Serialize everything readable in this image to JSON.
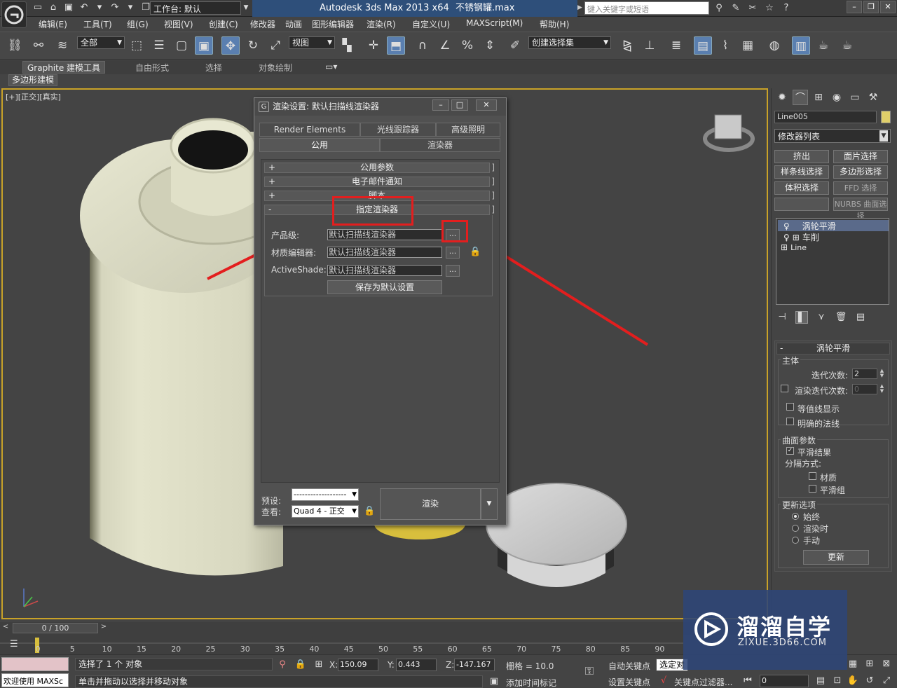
{
  "titlebar": {
    "workspace": "工作台: 默认",
    "app_title": "Autodesk 3ds Max  2013 x64",
    "file_name": "不锈钢罐.max",
    "search_placeholder": "键入关键字或短语"
  },
  "menu": [
    "编辑(E)",
    "工具(T)",
    "组(G)",
    "视图(V)",
    "创建(C)",
    "修改器",
    "动画",
    "图形编辑器",
    "渲染(R)",
    "自定义(U)",
    "MAXScript(M)",
    "帮助(H)"
  ],
  "toolbar": {
    "selection_filter": "全部",
    "ref_coord": "视图",
    "named_selection": "创建选择集"
  },
  "ribbon": {
    "tabs": [
      "Graphite 建模工具",
      "自由形式",
      "选择",
      "对象绘制"
    ],
    "sub_label": "多边形建模"
  },
  "viewport": {
    "label": "[+][正交][真实]"
  },
  "command_panel": {
    "object_name": "Line005",
    "modifier_list": "修改器列表",
    "buttons": [
      "挤出",
      "面片选择",
      "样条线选择",
      "多边形选择",
      "体积选择",
      "FFD 选择",
      "",
      "NURBS 曲面选择"
    ],
    "stack": [
      "涡轮平滑",
      "车削",
      "Line"
    ],
    "rollout_title": "涡轮平滑",
    "main_group": "主体",
    "iterations_label": "迭代次数:",
    "iterations_value": "2",
    "render_iters_label": "渲染迭代次数:",
    "render_iters_value": "0",
    "isoline": "等值线显示",
    "explicit_normals": "明确的法线",
    "surface_group": "曲面参数",
    "smooth_result": "平滑结果",
    "separate_by": "分隔方式:",
    "materials": "材质",
    "smoothing_groups": "平滑组",
    "update_group": "更新选项",
    "always": "始终",
    "when_rendering": "渲染时",
    "manually": "手动",
    "update_btn": "更新"
  },
  "dialog": {
    "title": "渲染设置: 默认扫描线渲染器",
    "tabs_row1": [
      "Render Elements",
      "光线跟踪器",
      "高级照明"
    ],
    "tabs_row2": [
      "公用",
      "渲染器"
    ],
    "rollouts": [
      {
        "sign": "+",
        "label": "公用参数"
      },
      {
        "sign": "+",
        "label": "电子邮件通知"
      },
      {
        "sign": "+",
        "label": "脚本"
      },
      {
        "sign": "-",
        "label": "指定渲染器"
      }
    ],
    "production_label": "产品级:",
    "production_value": "默认扫描线渲染器",
    "material_editor_label": "材质编辑器:",
    "material_editor_value": "默认扫描线渲染器",
    "activeshade_label": "ActiveShade:",
    "activeshade_value": "默认扫描线渲染器",
    "dots": "...",
    "save_default": "保存为默认设置",
    "preset_label": "预设:",
    "preset_value": "-------------------",
    "view_label": "查看:",
    "view_value": "Quad 4 - 正交",
    "render_btn": "渲染"
  },
  "timeline": {
    "frame_display": "0 / 100",
    "ticks": [
      "0",
      "5",
      "10",
      "15",
      "20",
      "25",
      "30",
      "35",
      "40",
      "45",
      "50",
      "55",
      "60",
      "65",
      "70",
      "75",
      "80",
      "85",
      "90"
    ]
  },
  "status": {
    "selection": "选择了 1 个 对象",
    "prompt": "单击并拖动以选择并移动对象",
    "welcome": "欢迎使用 MAXSc",
    "x_label": "X:",
    "x_value": "150.09",
    "y_label": "Y:",
    "y_value": "0.443",
    "z_label": "Z:",
    "z_value": "-147.167",
    "grid": "栅格 = 10.0",
    "add_time_tag": "添加时间标记",
    "auto_key": "自动关键点",
    "set_key": "设置关键点",
    "selected": "选定对",
    "key_filters": "关键点过滤器...",
    "frame": "0"
  },
  "watermark": {
    "title": "溜溜自学",
    "sub": "ZIXUE.3D66.COM"
  }
}
